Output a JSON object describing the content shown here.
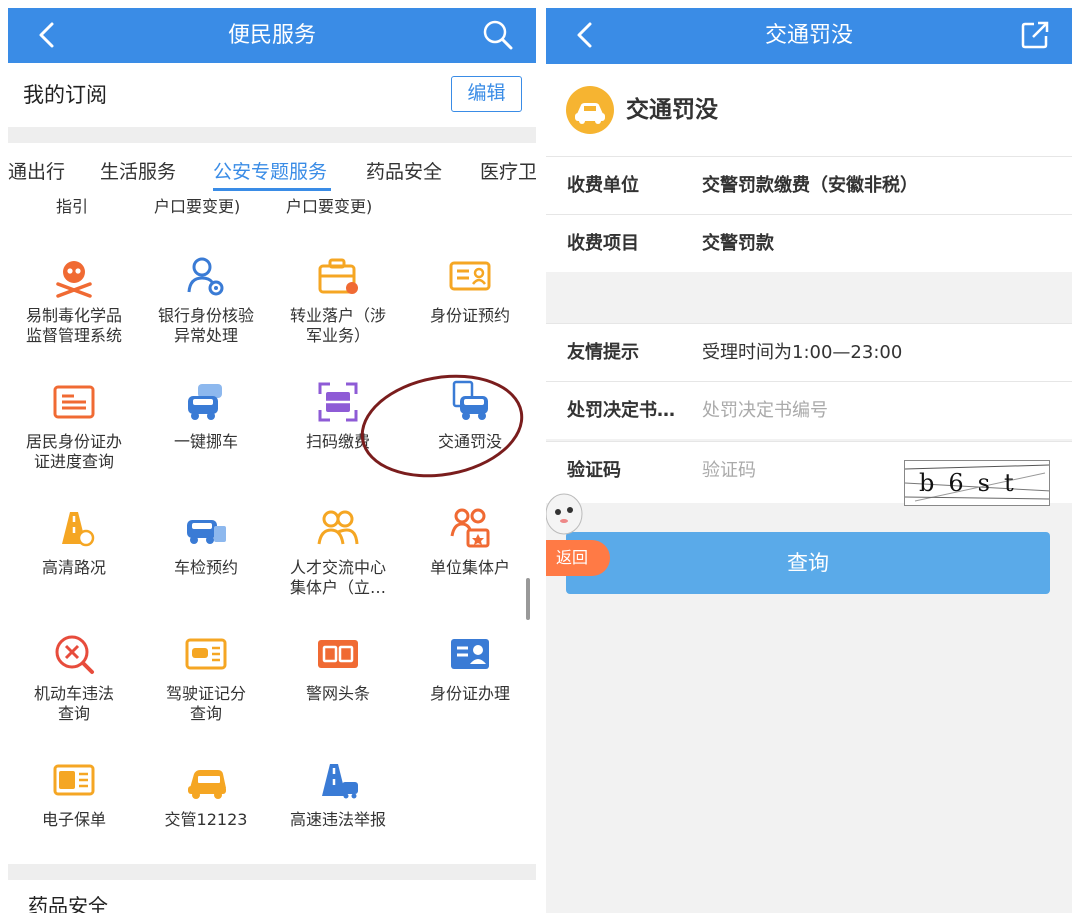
{
  "left": {
    "nav_title": "便民服务",
    "subscription_label": "我的订阅",
    "edit_label": "编辑",
    "tabs": [
      "通出行",
      "生活服务",
      "公安专题服务",
      "药品安全",
      "医疗卫"
    ],
    "active_tab_index": 2,
    "cut_row": [
      "指引",
      "户口要变更)",
      "户口要变更)"
    ],
    "grid": [
      {
        "label": "易制毒化学品\n监督管理系统",
        "icon": "skull-icon",
        "color": "#f06a33"
      },
      {
        "label": "银行身份核验\n异常处理",
        "icon": "person-gear-icon",
        "color": "#3a7bd5"
      },
      {
        "label": "转业落户（涉\n军业务）",
        "icon": "briefcase-pin-icon",
        "color": "#f5a623"
      },
      {
        "label": "身份证预约",
        "icon": "id-card-icon",
        "color": "#f5a623"
      },
      {
        "label": "居民身份证办\n证进度查询",
        "icon": "resident-card-icon",
        "color": "#f06a33"
      },
      {
        "label": "一键挪车",
        "icon": "cars-icon",
        "color": "#3a7bd5"
      },
      {
        "label": "扫码缴费",
        "icon": "scan-icon",
        "color": "#8e5bd6"
      },
      {
        "label": "交通罚没",
        "icon": "traffic-fine-icon",
        "color": "#3a7bd5"
      },
      {
        "label": "高清路况",
        "icon": "road-icon",
        "color": "#f5a623"
      },
      {
        "label": "车检预约",
        "icon": "car-inspect-icon",
        "color": "#3a7bd5"
      },
      {
        "label": "人才交流中心\n集体户（立…",
        "icon": "people-icon",
        "color": "#f5a623"
      },
      {
        "label": "单位集体户",
        "icon": "group-household-icon",
        "color": "#f06a33"
      },
      {
        "label": "机动车违法\n查询",
        "icon": "violation-icon",
        "color": "#e74c3c"
      },
      {
        "label": "驾驶证记分\n查询",
        "icon": "license-points-icon",
        "color": "#f5a623"
      },
      {
        "label": "警网头条",
        "icon": "headline-icon",
        "color": "#f06a33"
      },
      {
        "label": "身份证办理",
        "icon": "id-process-icon",
        "color": "#3a7bd5"
      },
      {
        "label": "电子保单",
        "icon": "e-policy-icon",
        "color": "#f5a623"
      },
      {
        "label": "交管12123",
        "icon": "tm12123-icon",
        "color": "#f5a623"
      },
      {
        "label": "高速违法举报",
        "icon": "highway-report-icon",
        "color": "#3a7bd5"
      }
    ],
    "bottom_section": "药品安全"
  },
  "right": {
    "nav_title": "交通罚没",
    "header_title": "交通罚没",
    "rows": [
      {
        "key": "收费单位",
        "value": "交警罚款缴费（安徽非税）"
      },
      {
        "key": "收费项目",
        "value": "交警罚款"
      }
    ],
    "tip_key": "友情提示",
    "tip_value": "受理时间为1:00—23:00",
    "decision_key": "处罚决定书…",
    "decision_placeholder": "处罚决定书编号",
    "captcha_key": "验证码",
    "captcha_placeholder": "验证码",
    "captcha_text": "b6st",
    "query_label": "查询",
    "return_label": "返回"
  },
  "colors": {
    "nav_blue": "#3a8ce6",
    "button_blue": "#5aaae9",
    "badge_orange": "#f6b431",
    "return_orange": "#ff7a45"
  }
}
